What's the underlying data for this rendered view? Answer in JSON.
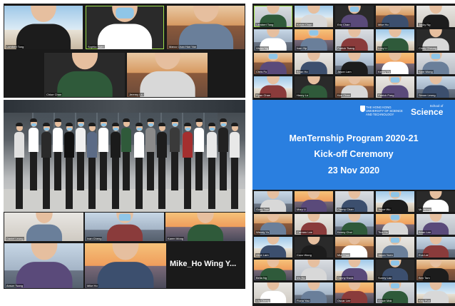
{
  "ceremony": {
    "university": "THE HONG KONG UNIVERSITY OF SCIENCE AND TECHNOLOGY",
    "school_prefix": "School of",
    "school": "Science",
    "title_line1": "MenTernship Program 2020-21",
    "title_line2": "Kick-off Ceremony",
    "date": "23 Nov 2020"
  },
  "featured_participant": "Mike_Ho Wing Y...",
  "tiles": {
    "top_left": [
      "Lambert Tong",
      "Sophia Yuen",
      "Marco Chan Hon Yan",
      "Chloe Chan",
      "Jeremy Liu"
    ],
    "bottom_left": [
      "Daniel Leung",
      "Ivan Cheng",
      "Karen Wong",
      "Anson Tsang",
      "Mike Ho",
      "Alex Lee",
      "Candy Lam"
    ],
    "top_right": [
      "Lambert Tong",
      "Kelvin Chan",
      "Eric Chan",
      "Mike Ho",
      "Jacky Ng",
      "Vivian Ng",
      "Ivan Yip",
      "Patrick Tsang",
      "Lucy Li",
      "Cindy Cheung",
      "Chris Fu",
      "Brian Ho",
      "Jason Lam",
      "Kenny Yu",
      "Sam Wong",
      "Ryan Chan",
      "Henry Lo",
      "Ken Chan",
      "Patrick Fung",
      "Simon Leung"
    ],
    "bottom_right": [
      "Goey Tam",
      "Mary Li",
      "Cherry Chan",
      "Joyce Wu",
      "Mr. Wong",
      "Wendy Yu",
      "Carmen Lee",
      "Kenny Choi",
      "Tina Ho",
      "Brian Lee",
      "Alice Lam",
      "Coco Wong",
      "Mia Chan",
      "Jason Yuen",
      "Eva Lai",
      "Bella Ng",
      "Iris Ho",
      "Danny Kwok",
      "Sunny Lau",
      "Ben Tam",
      "Lily Cheng",
      "Fiona Yau",
      "Oscar Lee",
      "Grace Mak",
      "Kitty Pun",
      "Terry Ng",
      "Ann Lo",
      "Peter Chow",
      "Helen Ho",
      "Roy Wong",
      "Zoe Kwan",
      "Nick Tse",
      "Ella Fung",
      "Max Chan",
      "Rita Lo"
    ]
  },
  "colors": {
    "banner_blue": "#2a7fe0",
    "active_speaker_outline": "#9fe04a",
    "panel_background": "#1a1a1a"
  }
}
